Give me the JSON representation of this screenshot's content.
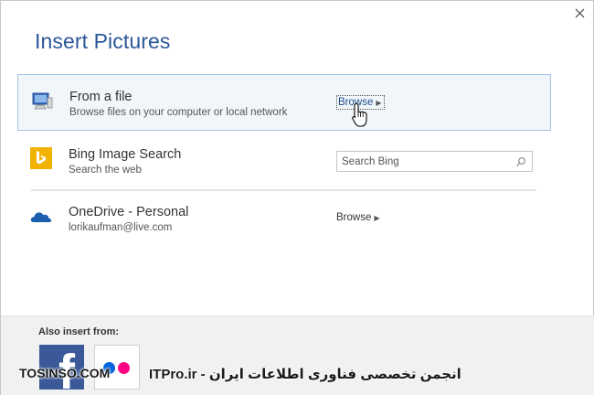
{
  "dialog": {
    "title": "Insert Pictures"
  },
  "sources": [
    {
      "name": "From a file",
      "description": "Browse files on your computer or local network",
      "action_label": "Browse",
      "icon": "computer-icon",
      "selected": true
    },
    {
      "name": "Bing Image Search",
      "description": "Search the web",
      "search_placeholder": "Search Bing",
      "icon": "bing-icon"
    },
    {
      "name": "OneDrive - Personal",
      "description": "lorikaufman@live.com",
      "action_label": "Browse",
      "icon": "onedrive-icon"
    }
  ],
  "also_insert": {
    "label": "Also insert from:",
    "services": [
      "facebook-icon",
      "flickr-icon"
    ]
  },
  "watermark": {
    "left": "TOSINSO.COM",
    "right": "ITPro.ir - انجمن تخصصی فناوری اطلاعات ایران"
  },
  "colors": {
    "title": "#2b579a",
    "selected_bg": "#f1f6fb",
    "selected_border": "#a4c3e4",
    "bing": "#f2b300",
    "onedrive": "#1b5fae",
    "facebook": "#3b5998",
    "flickr_blue": "#0063dc",
    "flickr_pink": "#ff0084"
  }
}
